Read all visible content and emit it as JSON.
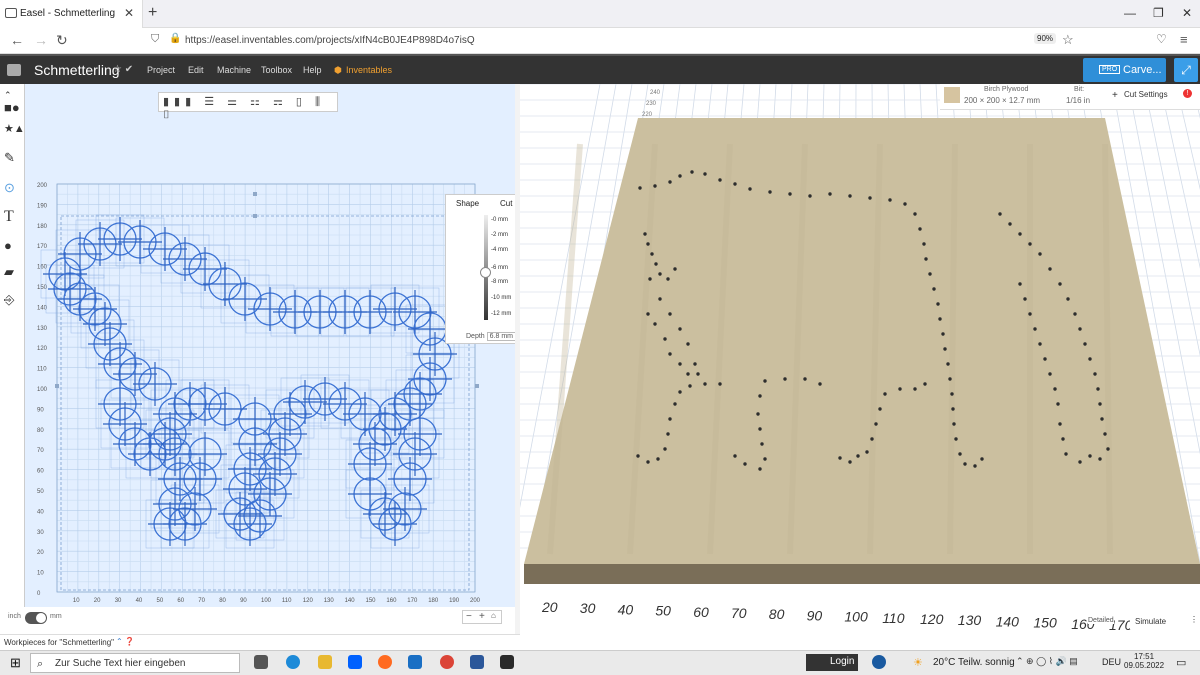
{
  "browser": {
    "tab_title": "Easel - Schmetterling",
    "url": "https://easel.inventables.com/projects/xIfN4cB0JE4P898D4o7isQ",
    "zoom": "90%"
  },
  "app": {
    "project_title": "Schmetterling",
    "menus": [
      "Project",
      "Edit",
      "Machine",
      "Toolbox",
      "Help",
      "Inventables"
    ],
    "pro_badge": "PRO",
    "carve_label": "Carve..."
  },
  "material": {
    "name": "Birch Plywood",
    "dimensions": "200 × 200 × 12.7 mm",
    "bit_label": "Bit:",
    "bit_value": "1/16 in",
    "cut_settings": "Cut Settings",
    "swatch_color": "#d6c4a0"
  },
  "depth_panel": {
    "tab_shape": "Shape",
    "tab_cut": "Cut",
    "levels": [
      "-0 mm",
      "-2 mm",
      "-4 mm",
      "-6 mm",
      "-8 mm",
      "-10 mm",
      "-12 mm"
    ],
    "depth_label": "Depth",
    "depth_value": "6.8 mm"
  },
  "canvas2d": {
    "y_ticks": [
      "200",
      "190",
      "180",
      "170",
      "160",
      "150",
      "140",
      "130",
      "120",
      "110",
      "100",
      "90",
      "80",
      "70",
      "60",
      "50",
      "40",
      "30",
      "20",
      "10",
      "0"
    ],
    "x_ticks": [
      "10",
      "20",
      "30",
      "40",
      "50",
      "60",
      "70",
      "80",
      "90",
      "100",
      "110",
      "120",
      "130",
      "140",
      "150",
      "160",
      "170",
      "180",
      "190",
      "200"
    ]
  },
  "bottom": {
    "unit_inch": "inch",
    "unit_mm": "mm",
    "workpieces": "Workpieces for \"Schmetterling\"",
    "zoom_minus": "−",
    "zoom_plus": "+"
  },
  "scale3d": {
    "top_ticks": [
      "240",
      "230",
      "220"
    ],
    "bottom_ticks": [
      "20",
      "30",
      "40",
      "50",
      "60",
      "70",
      "80",
      "90",
      "100",
      "110",
      "120",
      "130",
      "140",
      "150",
      "160",
      "170"
    ]
  },
  "sim": {
    "detailed": "Detailed",
    "simulate": "Simulate"
  },
  "taskbar": {
    "search_placeholder": "Zur Suche Text hier eingeben",
    "login": "Login",
    "weather": "20°C  Teilw. sonnig",
    "lang": "DEU",
    "time": "17:51",
    "date": "09.05.2022"
  }
}
